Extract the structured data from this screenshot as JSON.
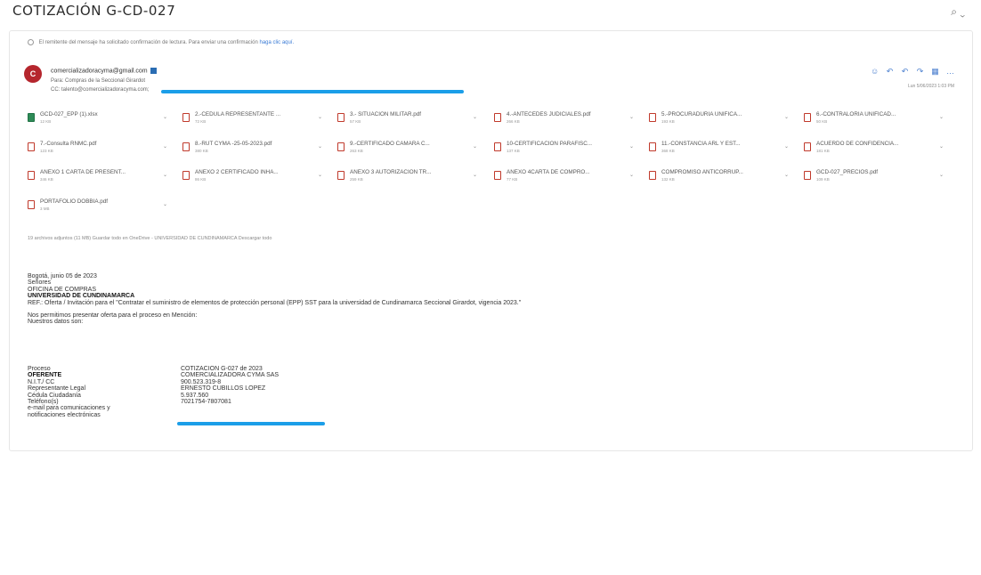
{
  "subject": "COTIZACIÓN G-CD-027",
  "toolbar": {
    "zoom_icon": "magnifier-icon",
    "zoom_label": "⌕ ⌄"
  },
  "notice": {
    "text": "El remitente del mensaje ha solicitado confirmación de lectura. Para enviar una confirmación",
    "link": "haga clic aquí."
  },
  "message": {
    "avatar_letter": "C",
    "avatar_color": "#b5262d",
    "sender": "comercializadoracyma@gmail.com",
    "to": "Para: Compras de la Seccional Girardot",
    "cc": "CC: talento@comercializadoracyma.com;",
    "date": "Lun 5/06/2023 1:03 PM"
  },
  "actions": {
    "items": [
      "☺",
      "↶",
      "↶",
      "↷",
      "▦",
      "…"
    ]
  },
  "attachments": [
    {
      "name": "GCD-027_EPP (1).xlsx",
      "size": "12 KB",
      "type": "xls"
    },
    {
      "name": "2.-CEDULA REPRESENTANTE ...",
      "size": "72 KB",
      "type": "pdf"
    },
    {
      "name": "3.- SITUACIÓN MILITAR.pdf",
      "size": "57 KB",
      "type": "pdf"
    },
    {
      "name": "4.-ANTECEDES JUDICIALES.pdf",
      "size": "266 KB",
      "type": "pdf"
    },
    {
      "name": "5.-PROCURADURIA UNIFICA...",
      "size": "193 KB",
      "type": "pdf"
    },
    {
      "name": "6.-CONTRALORIA UNIFICAD...",
      "size": "50 KB",
      "type": "pdf"
    },
    {
      "name": "7.-Consulta RNMC.pdf",
      "size": "123 KB",
      "type": "pdf"
    },
    {
      "name": "8.-RUT CYMA -25-05-2023.pdf",
      "size": "380 KB",
      "type": "pdf"
    },
    {
      "name": "9.-CERTIFICADO CAMARA C...",
      "size": "263 KB",
      "type": "pdf"
    },
    {
      "name": "10-CERTIFICACION PARAFISC...",
      "size": "137 KB",
      "type": "pdf"
    },
    {
      "name": "11.-CONSTANCIA ARL Y EST...",
      "size": "368 KB",
      "type": "pdf"
    },
    {
      "name": "ACUERDO DE CONFIDENCIA...",
      "size": "181 KB",
      "type": "pdf"
    },
    {
      "name": "ANEXO 1 CARTA DE PRESENT...",
      "size": "346 KB",
      "type": "pdf"
    },
    {
      "name": "ANEXO 2 CERTIFICADO INHA...",
      "size": "86 KB",
      "type": "pdf"
    },
    {
      "name": "ANEXO 3 AUTORIZACION TR...",
      "size": "259 KB",
      "type": "pdf"
    },
    {
      "name": "ANEXO 4CARTA DE COMPRO...",
      "size": "77 KB",
      "type": "pdf"
    },
    {
      "name": "COMPROMISO ANTICORRUP...",
      "size": "132 KB",
      "type": "pdf"
    },
    {
      "name": "GCD-027_PRECIOS.pdf",
      "size": "109 KB",
      "type": "pdf"
    },
    {
      "name": "PORTAFOLIO DOBBIA.pdf",
      "size": "3 MB",
      "type": "pdf"
    }
  ],
  "attachment_summary": "19 archivos adjuntos (11 MB)   Guardar todo en OneDrive - UNIVERSIDAD DE CUNDINAMARCA   Descargar todo",
  "body": {
    "greeting_date": "Bogotá, junio 05 de 2023",
    "salutation": "Señores",
    "office": "OFICINA DE COMPRAS",
    "university": "UNIVERSIDAD DE CUNDINAMARCA",
    "ref": "REF.: Oferta / Invitación para el \"Contratar el suministro de elementos de protección personal (EPP) SST para la universidad de Cundinamarca Seccional Girardot, vigencia 2023.\"",
    "intro1": "Nos permitimos presentar oferta para el proceso en Mención:",
    "intro2": "Nuestros datos son:"
  },
  "details": [
    {
      "label": "Proceso",
      "value": "COTIZACION G-027 de 2023",
      "bold": false
    },
    {
      "label": "OFERENTE",
      "value": "COMERCIALIZADORA CYMA SAS",
      "bold": true
    },
    {
      "label": "N.I.T./ CC",
      "value": "900.523.319-8",
      "bold": false
    },
    {
      "label": "Representante Legal",
      "value": "ERNESTO CUBILLOS LOPEZ",
      "bold": false
    },
    {
      "label": "Cédula Ciudadanía",
      "value": "5.937.560",
      "bold": false
    },
    {
      "label": "Teléfono(s)",
      "value": "7021754-7807081",
      "bold": false
    },
    {
      "label": "e-mail para comunicaciones y",
      "value": "",
      "bold": false
    },
    {
      "label": "notificaciones electrónicas",
      "value": "",
      "bold": false
    }
  ]
}
